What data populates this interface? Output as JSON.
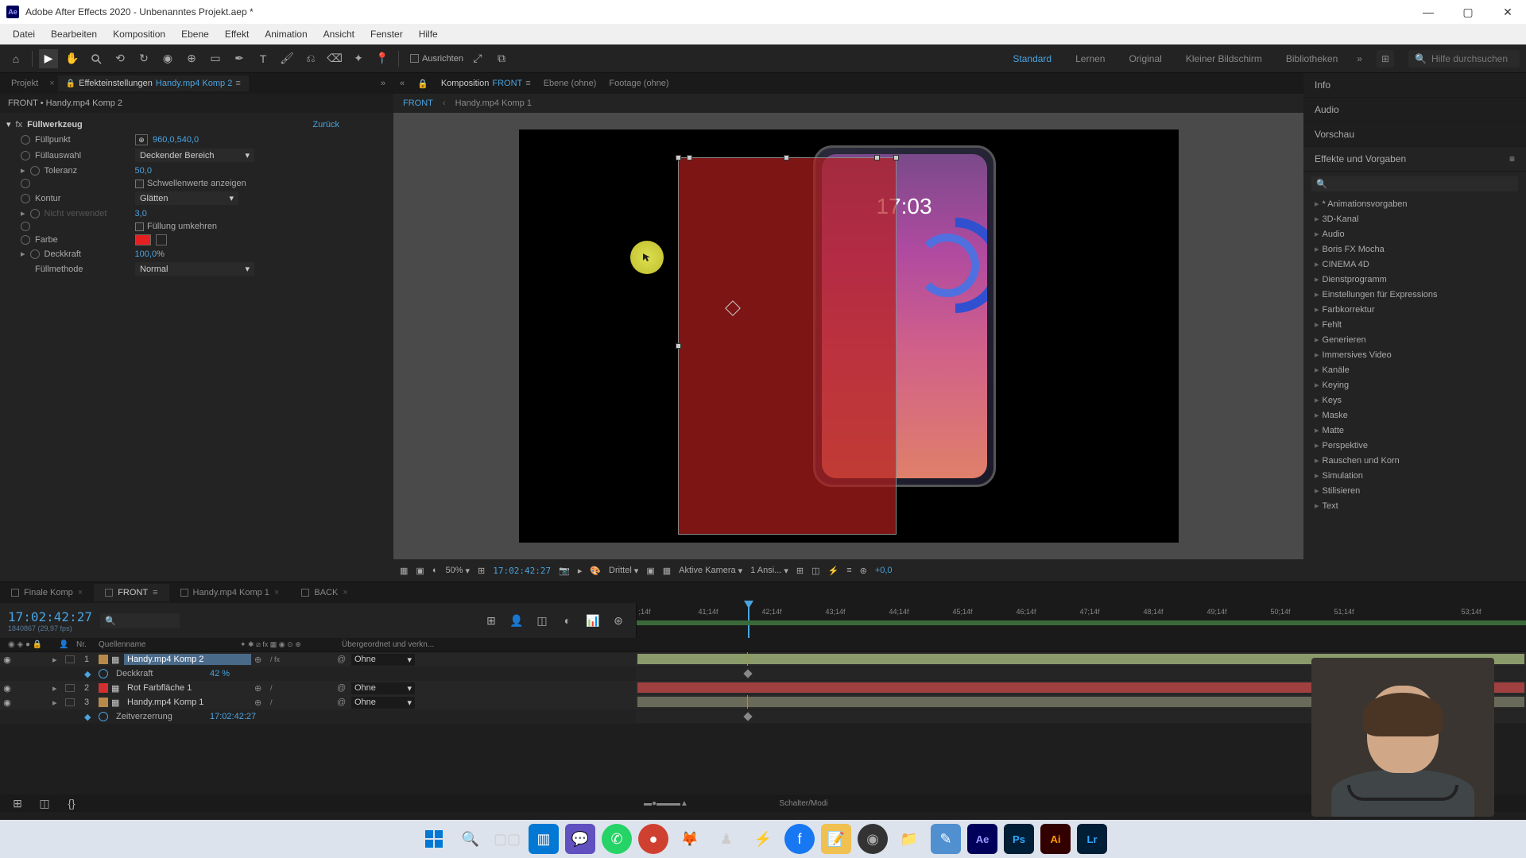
{
  "title": "Adobe After Effects 2020 - Unbenanntes Projekt.aep *",
  "menu": [
    "Datei",
    "Bearbeiten",
    "Komposition",
    "Ebene",
    "Effekt",
    "Animation",
    "Ansicht",
    "Fenster",
    "Hilfe"
  ],
  "snap_label": "Ausrichten",
  "workspaces": {
    "items": [
      "Standard",
      "Lernen",
      "Original",
      "Kleiner Bildschirm",
      "Bibliotheken"
    ],
    "active": "Standard"
  },
  "search_placeholder": "Hilfe durchsuchen",
  "left_tabs": {
    "project": "Projekt",
    "fx_settings": "Effekteinstellungen",
    "fx_target": "Handy.mp4 Komp 2"
  },
  "crumb": "FRONT • Handy.mp4 Komp 2",
  "fx": {
    "name": "Füllwerkzeug",
    "reset": "Zurück",
    "fillpoint": {
      "label": "Füllpunkt",
      "value": "960,0,540,0"
    },
    "fillsel": {
      "label": "Füllauswahl",
      "value": "Deckender Bereich"
    },
    "tolerance": {
      "label": "Toleranz",
      "value": "50,0"
    },
    "threshold_label": "Schwellenwerte anzeigen",
    "contour": {
      "label": "Kontur",
      "value": "Glätten"
    },
    "radius": {
      "label": "",
      "value": "3,0"
    },
    "unused": "Nicht verwendet",
    "invert_label": "Füllung umkehren",
    "color_label": "Farbe",
    "opacity": {
      "label": "Deckkraft",
      "value": "100,0",
      "suffix": "%"
    },
    "blend": {
      "label": "Füllmethode",
      "value": "Normal"
    }
  },
  "comp_tabs": {
    "comp": "Komposition",
    "comp_name": "FRONT",
    "layer": "Ebene (ohne)",
    "footage": "Footage (ohne)"
  },
  "comp_nav": [
    "FRONT",
    "Handy.mp4 Komp 1"
  ],
  "phone_time": "17:03",
  "viewer_footer": {
    "zoom": "50%",
    "timecode": "17:02:42:27",
    "res": "Drittel",
    "camera": "Aktive Kamera",
    "views": "1 Ansi...",
    "exposure": "+0,0"
  },
  "right_tabs": [
    "Info",
    "Audio",
    "Vorschau"
  ],
  "fx_presets_label": "Effekte und Vorgaben",
  "fx_tree": [
    "* Animationsvorgaben",
    "3D-Kanal",
    "Audio",
    "Boris FX Mocha",
    "CINEMA 4D",
    "Dienstprogramm",
    "Einstellungen für Expressions",
    "Farbkorrektur",
    "Fehlt",
    "Generieren",
    "Immersives Video",
    "Kanäle",
    "Keying",
    "Keys",
    "Maske",
    "Matte",
    "Perspektive",
    "Rauschen und Korn",
    "Simulation",
    "Stilisieren",
    "Text"
  ],
  "tl_tabs": [
    "Finale Komp",
    "FRONT",
    "Handy.mp4 Komp 1",
    "BACK"
  ],
  "tl_active_tab": "FRONT",
  "tl_timecode": "17:02:42:27",
  "tl_fps": "1840867 (29,97 fps)",
  "tl_col_nr": "Nr.",
  "tl_col_src": "Quellenname",
  "tl_col_parent": "Übergeordnet und verkn...",
  "tl_none": "Ohne",
  "ruler": [
    ";14f",
    "41;14f",
    "42;14f",
    "43;14f",
    "44;14f",
    "45;14f",
    "46;14f",
    "47;14f",
    "48;14f",
    "49;14f",
    "50;14f",
    "51;14f",
    "",
    "53;14f"
  ],
  "layers": [
    {
      "num": "1",
      "name": "Handy.mp4 Komp 2",
      "color": "#b88a4a",
      "selected": true,
      "sub": [
        {
          "label": "Deckkraft",
          "value": "42 %"
        }
      ]
    },
    {
      "num": "2",
      "name": "Rot Farbfläche 1",
      "color": "#d03030",
      "selected": false
    },
    {
      "num": "3",
      "name": "Handy.mp4 Komp 1",
      "color": "#b88a4a",
      "selected": false,
      "sub": [
        {
          "label": "Zeitverzerrung",
          "value": "17:02:42:27"
        }
      ]
    }
  ],
  "tl_footer": "Schalter/Modi"
}
